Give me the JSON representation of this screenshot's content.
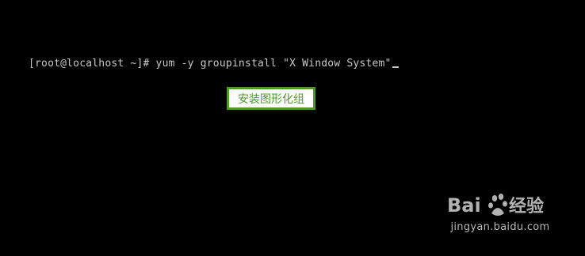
{
  "terminal": {
    "prompt": "[root@localhost ~]# ",
    "command": "yum -y groupinstall \"X Window System\""
  },
  "callout": {
    "label": "安装图形化组"
  },
  "watermark": {
    "brand": "Baidu",
    "brand_cn": "经验",
    "url": "jingyan.baidu.com"
  },
  "colors": {
    "background": "#000000",
    "terminal_text": "#c8c8c8",
    "callout_border": "#4c9a2a"
  }
}
